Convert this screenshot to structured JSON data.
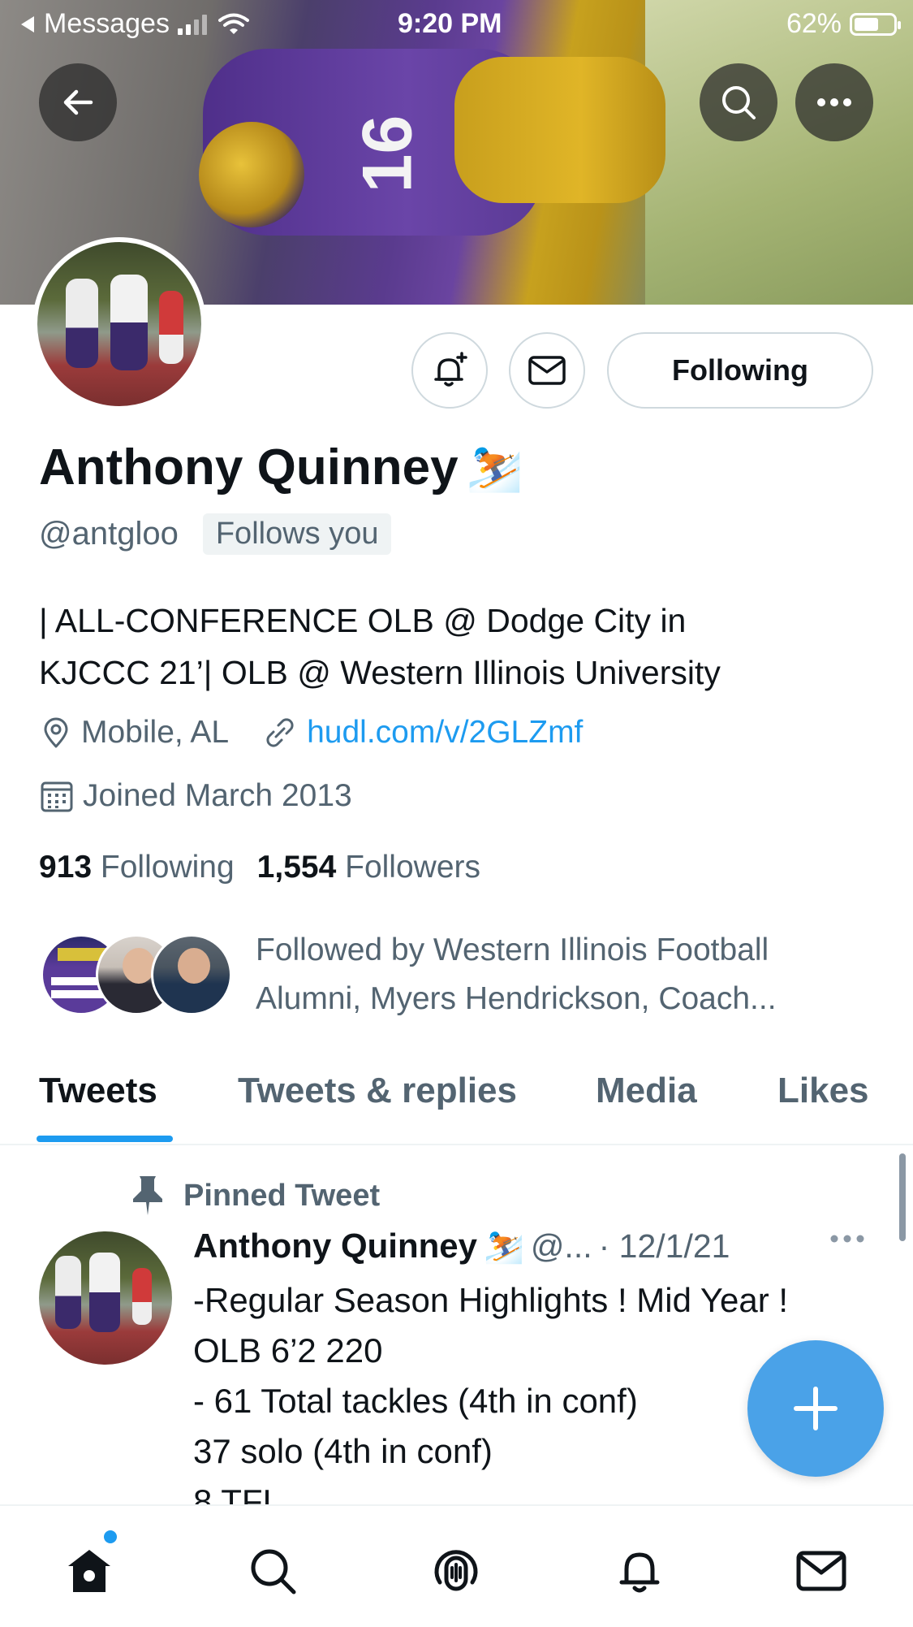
{
  "status_bar": {
    "back_app": "Messages",
    "time": "9:20 PM",
    "battery": "62%",
    "battery_level": 0.62
  },
  "header": {
    "back_icon": "arrow-left-icon",
    "search_icon": "search-icon",
    "more_icon": "more-horizontal-icon"
  },
  "profile": {
    "name": "Anthony Quinney",
    "name_emoji": "⛷️",
    "handle": "@antgloo",
    "follows_you": "Follows you",
    "bio_line1": "| ALL-CONFERENCE OLB @ Dodge City in",
    "bio_line2": "KJCCC 21’| OLB @ Western Illinois University",
    "location": "Mobile, AL",
    "link": "hudl.com/v/2GLZmf",
    "joined": "Joined March 2013",
    "following_count": "913",
    "following_label": "Following",
    "followers_count": "1,554",
    "followers_label": "Followers",
    "followed_by_line1": "Followed by Western Illinois Football",
    "followed_by_line2": "Alumni, Myers Hendrickson, Coach...",
    "banner_jersey_number": "16"
  },
  "actions": {
    "notify_icon": "bell-plus-icon",
    "message_icon": "envelope-icon",
    "following_label": "Following"
  },
  "tabs": [
    {
      "label": "Tweets",
      "active": true
    },
    {
      "label": "Tweets & replies",
      "active": false
    },
    {
      "label": "Media",
      "active": false
    },
    {
      "label": "Likes",
      "active": false
    }
  ],
  "pinned": {
    "label": "Pinned Tweet",
    "author": "Anthony Quinney",
    "emoji": "⛷️",
    "handle": "@...",
    "date": "· 12/1/21",
    "lines": [
      "-Regular Season Highlights ! Mid Year !",
      "OLB 6’2 220",
      "- 61 Total tackles (4th in conf)",
      "37 solo (4th in conf)",
      "8 TFL"
    ]
  },
  "colors": {
    "accent": "#1d9bf0",
    "text_primary": "#0f1419",
    "text_secondary": "#536471",
    "fab": "#4aa2e8"
  },
  "bottom_nav": [
    "home-icon",
    "search-icon",
    "spaces-icon",
    "bell-icon",
    "envelope-icon"
  ]
}
